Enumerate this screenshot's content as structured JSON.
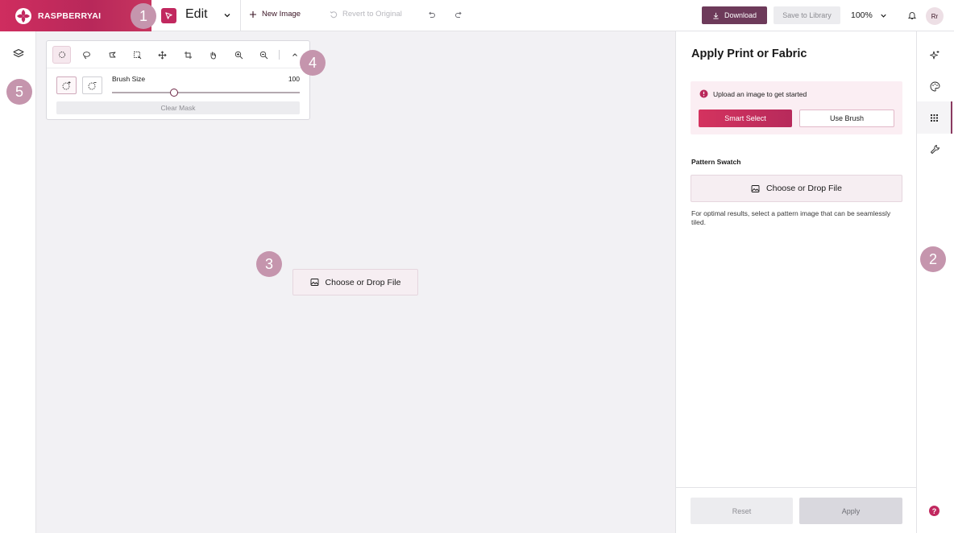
{
  "brand": {
    "name": "RASPBERRYAI"
  },
  "toolbar": {
    "mode_label": "Edit",
    "new_image": "New Image",
    "revert": "Revert to Original",
    "download": "Download",
    "save": "Save to Library",
    "zoom": "100%",
    "avatar_initials": "Rr"
  },
  "tool_panel": {
    "tools": [
      "ellipse-select-icon",
      "lasso-icon",
      "polygon-lasso-icon",
      "rect-select-icon",
      "move-icon",
      "crop-icon",
      "hand-icon",
      "zoom-in-icon",
      "zoom-out-icon",
      "collapse-icon"
    ],
    "brush_size_label": "Brush Size",
    "brush_size_value": "100",
    "brush_size_fraction": 0.33,
    "clear_mask": "Clear Mask"
  },
  "canvas": {
    "drop_label": "Choose or Drop File"
  },
  "right_panel": {
    "title": "Apply Print or Fabric",
    "notice": "Upload an image to get started",
    "smart_select": "Smart Select",
    "use_brush": "Use Brush",
    "swatch_label": "Pattern Swatch",
    "swatch_drop": "Choose or Drop File",
    "swatch_help": "For optimal results, select a pattern image that can be seamlessly tiled.",
    "reset": "Reset",
    "apply": "Apply"
  },
  "right_rail": {
    "items": [
      "sparkle-icon",
      "palette-icon",
      "pattern-grid-icon",
      "wrench-icon"
    ],
    "active_index": 2,
    "help": "?"
  },
  "callouts": [
    "1",
    "2",
    "3",
    "4",
    "5"
  ],
  "colors": {
    "brand": "#c1285f",
    "download": "#6d3a5a",
    "canvas_bg": "#f2f1f4",
    "callout": "#c595ad"
  }
}
